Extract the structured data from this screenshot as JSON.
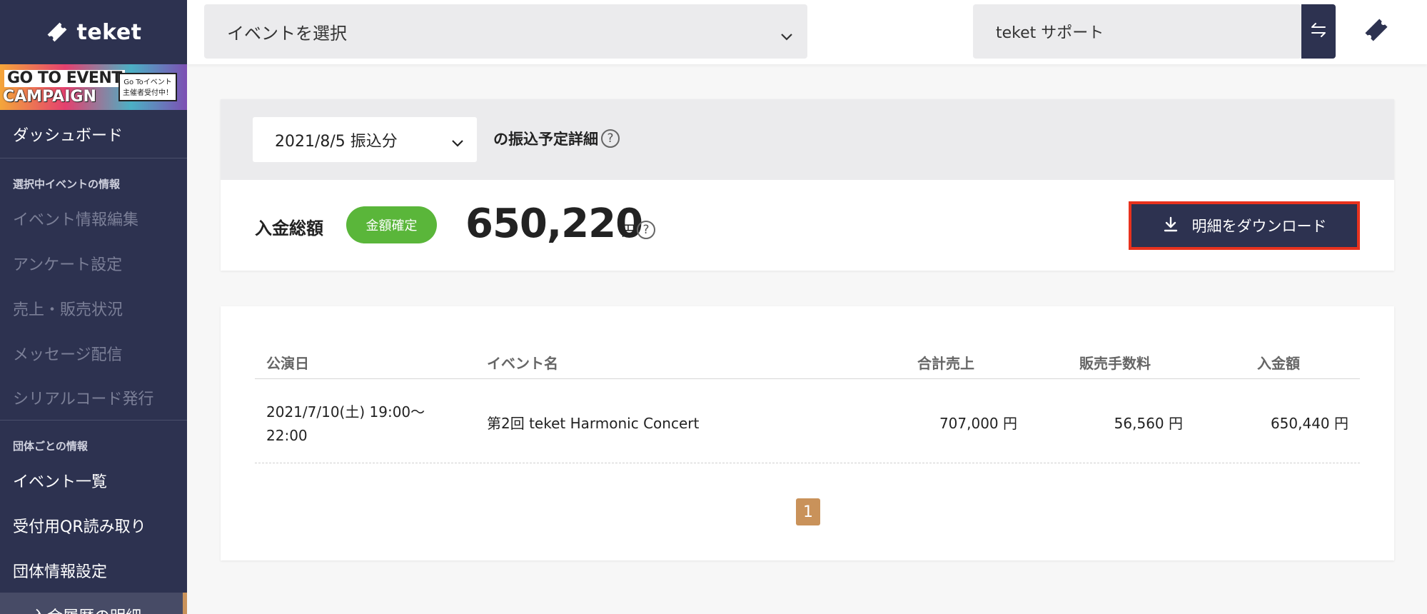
{
  "brand": {
    "name": "teket"
  },
  "banner": {
    "line1": "GO TO EVENT",
    "line2": "CAMPAIGN",
    "box_line1": "Go Toイベント",
    "box_line2": "主催者受付中！"
  },
  "sidebar": {
    "dashboard": "ダッシュボード",
    "section_event": "選択中イベントの情報",
    "event_items": [
      {
        "label": "イベント情報編集"
      },
      {
        "label": "アンケート設定"
      },
      {
        "label": "売上・販売状況"
      },
      {
        "label": "メッセージ配信"
      },
      {
        "label": "シリアルコード発行"
      }
    ],
    "section_org": "団体ごとの情報",
    "org_items": [
      {
        "label": "イベント一覧"
      },
      {
        "label": "受付用QR読み取り"
      },
      {
        "label": "団体情報設定"
      }
    ],
    "active_item": "入金履歴の明細"
  },
  "topbar": {
    "event_select_placeholder": "イベントを選択",
    "support_label": "teket サポート"
  },
  "summary": {
    "date_option": "2021/8/5 振込分",
    "header_label": "の振込予定詳細",
    "help_glyph": "?",
    "total_label": "入金総額",
    "status": "金額確定",
    "total_amount": "650,220",
    "unit": "円",
    "download_label": "明細をダウンロード"
  },
  "table": {
    "columns": [
      "公演日",
      "イベント名",
      "合計売上",
      "販売手数料",
      "入金額"
    ],
    "rows": [
      {
        "date_line1": "2021/7/10(土) 19:00〜",
        "date_line2": "22:00",
        "name": "第2回 teket Harmonic Concert",
        "sales": "707,000 円",
        "fee": "56,560 円",
        "payment": "650,440 円"
      }
    ],
    "current_page": "1"
  },
  "colors": {
    "sidebar_bg": "#2d3250",
    "accent": "#c9925a",
    "badge_green": "#5ab63a",
    "highlight_red": "#e8321e"
  }
}
